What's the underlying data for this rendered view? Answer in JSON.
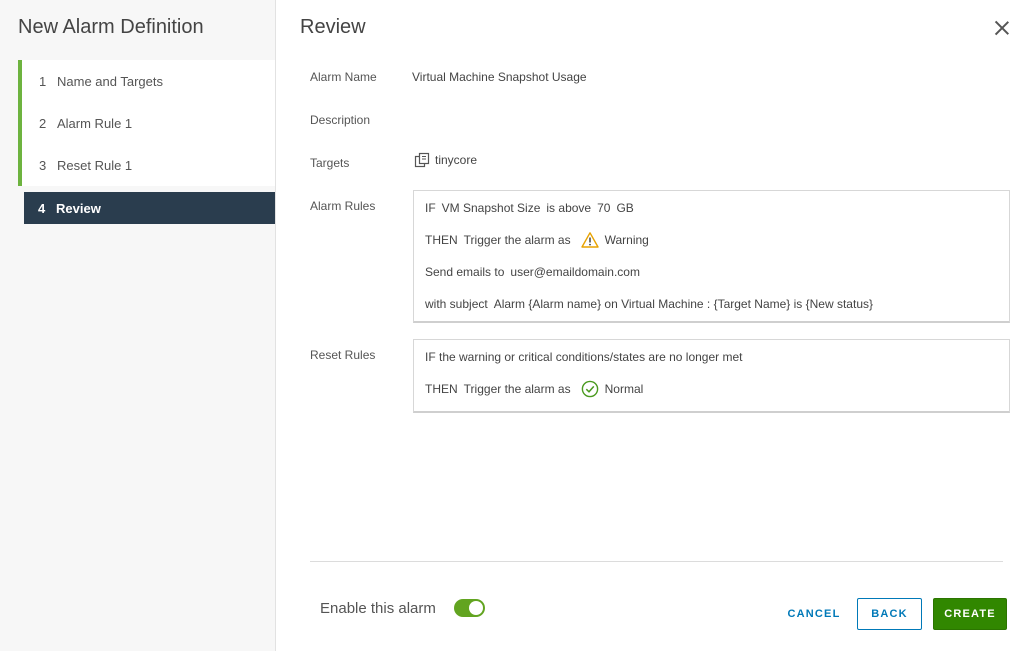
{
  "wizard": {
    "title": "New Alarm Definition",
    "steps": [
      {
        "num": "1",
        "label": "Name and Targets"
      },
      {
        "num": "2",
        "label": "Alarm Rule 1"
      },
      {
        "num": "3",
        "label": "Reset Rule 1"
      },
      {
        "num": "4",
        "label": "Review"
      }
    ],
    "active_step": 4
  },
  "review": {
    "title": "Review",
    "alarm_name_label": "Alarm Name",
    "alarm_name": "Virtual Machine Snapshot Usage",
    "description_label": "Description",
    "targets_label": "Targets",
    "target": "tinycore",
    "target_icon": "vm-icon",
    "alarm_rules_label": "Alarm Rules",
    "alarm_rules": {
      "if_kw": "IF",
      "metric": "VM Snapshot Size",
      "operator": "is above",
      "threshold": "70",
      "unit": "GB",
      "then_kw": "THEN",
      "trigger_text": "Trigger the alarm as",
      "severity": "Warning",
      "severity_icon": "warning-triangle-icon",
      "email_text": "Send emails to",
      "email": "user@emaildomain.com",
      "subject_text": "with subject",
      "subject": "Alarm {Alarm name} on Virtual Machine : {Target Name} is {New status}"
    },
    "reset_rules_label": "Reset Rules",
    "reset_rules": {
      "condition": "IF the warning or critical conditions/states are no longer met",
      "then_kw": "THEN",
      "trigger_text": "Trigger the alarm as",
      "severity": "Normal",
      "severity_icon": "check-circle-icon"
    }
  },
  "footer": {
    "enable_label": "Enable this alarm",
    "enabled": true,
    "cancel_label": "CANCEL",
    "back_label": "BACK",
    "create_label": "CREATE"
  },
  "colors": {
    "step_accent": "#6db33f",
    "active_step_bg": "#2a3d4e",
    "toggle_on": "#62a420",
    "primary_button": "#318700",
    "link_blue": "#0079b8",
    "warning": "#e8a200",
    "normal": "#4a9a1f"
  }
}
